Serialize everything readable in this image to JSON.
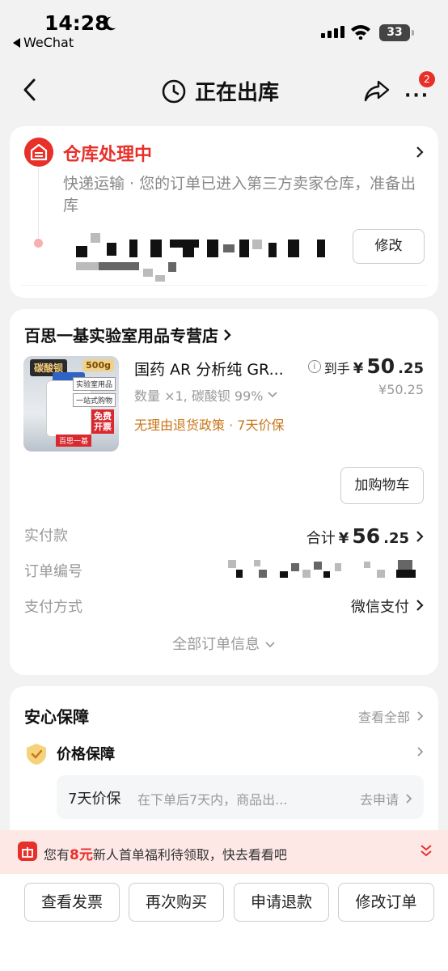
{
  "status_bar": {
    "time": "14:28",
    "back_app": "WeChat",
    "battery": "33"
  },
  "nav": {
    "title": "正在出库",
    "badge": "2"
  },
  "logistics": {
    "status_title": "仓库处理中",
    "description": "快递运输 · 您的订单已进入第三方卖家仓库，准备出库",
    "modify_label": "修改"
  },
  "order": {
    "shop_name": "百思一基实验室用品专营店",
    "product": {
      "title": "国药 AR 分析纯 GR...",
      "spec": "数量 ×1, 碳酸钡 99%",
      "policy": "无理由退货政策 · 7天价保",
      "price_label": "到手",
      "price_currency": "¥",
      "price_int": "50",
      "price_dec": ".25",
      "original_price": "¥50.25",
      "image_text": {
        "label": "碳酸钡",
        "weight": "500g",
        "tag1": "实验室用品",
        "tag2": "一站式购物",
        "free": "免费开票",
        "brand": "百思一基"
      }
    },
    "add_to_cart_label": "加购物车",
    "rows": {
      "paid": {
        "key": "实付款",
        "prefix": "合计",
        "currency": "¥",
        "int": "56",
        "dec": ".25"
      },
      "order_no": {
        "key": "订单编号"
      },
      "payment": {
        "key": "支付方式",
        "value": "微信支付"
      }
    },
    "all_info_label": "全部订单信息"
  },
  "guarantee": {
    "title": "安心保障",
    "view_all": "查看全部",
    "item": "价格保障",
    "sub": {
      "name": "7天价保",
      "desc": "在下单后7天内，商品出...",
      "action": "去申请"
    }
  },
  "promo": {
    "pre": "您有",
    "amount": "8元",
    "post": "新人首单福利待领取，快去看看吧"
  },
  "actions": [
    "查看发票",
    "再次购买",
    "申请退款",
    "修改订单"
  ],
  "colors": {
    "accent_red": "#e8302a",
    "policy_orange": "#c8761a",
    "background": "#f2f2f2"
  }
}
